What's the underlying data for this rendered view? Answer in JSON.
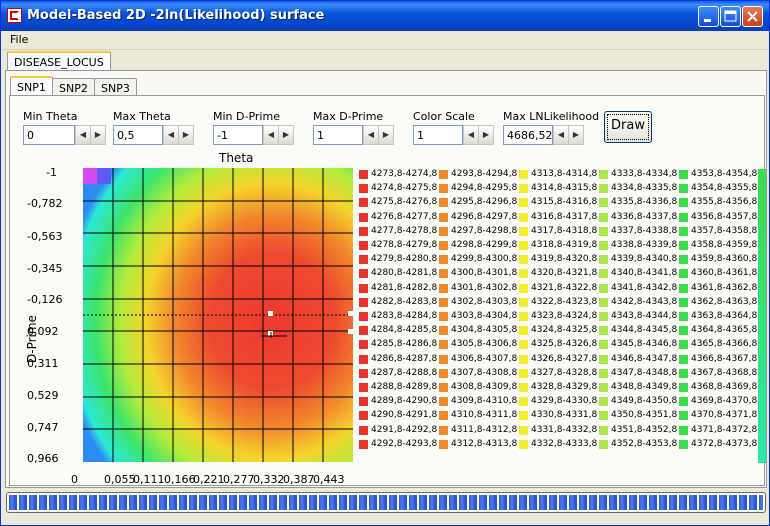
{
  "window": {
    "title": "Model-Based 2D -2ln(Likelihood) surface"
  },
  "menu": {
    "file": "File"
  },
  "tabs_outer": [
    "DISEASE_LOCUS"
  ],
  "tabs_inner": [
    "SNP1",
    "SNP2",
    "SNP3"
  ],
  "controls": {
    "min_theta": {
      "label": "Min Theta",
      "value": "0"
    },
    "max_theta": {
      "label": "Max Theta",
      "value": "0,5"
    },
    "min_dprime": {
      "label": "Min D-Prime",
      "value": "-1"
    },
    "max_dprime": {
      "label": "Max D-Prime",
      "value": "1"
    },
    "color_scale": {
      "label": "Color Scale",
      "value": "1"
    },
    "max_lnl": {
      "label": "Max LNLikelihood",
      "value": "4686,52"
    },
    "draw": "Draw"
  },
  "plot": {
    "x_title": "Theta",
    "y_title": "D-Prime",
    "y_ticks": [
      "-1",
      "-0,782",
      "-0,563",
      "-0,345",
      "-0,126",
      "0,092",
      "0,311",
      "0,529",
      "0,747",
      "0,966"
    ],
    "x_ticks": [
      "0",
      "0,055",
      "0,111",
      "0,166",
      "0,221",
      "0,277",
      "0,332",
      "0,387",
      "0,443"
    ]
  },
  "legend": {
    "columns": [
      [
        "4273,8-4274,8",
        "4274,8-4275,8",
        "4275,8-4276,8",
        "4276,8-4277,8",
        "4277,8-4278,8",
        "4278,8-4279,8",
        "4279,8-4280,8",
        "4280,8-4281,8",
        "4281,8-4282,8",
        "4282,8-4283,8",
        "4283,8-4284,8",
        "4284,8-4285,8",
        "4285,8-4286,8",
        "4286,8-4287,8",
        "4287,8-4288,8",
        "4288,8-4289,8",
        "4289,8-4290,8",
        "4290,8-4291,8",
        "4291,8-4292,8",
        "4292,8-4293,8"
      ],
      [
        "4293,8-4294,8",
        "4294,8-4295,8",
        "4295,8-4296,8",
        "4296,8-4297,8",
        "4297,8-4298,8",
        "4298,8-4299,8",
        "4299,8-4300,8",
        "4300,8-4301,8",
        "4301,8-4302,8",
        "4302,8-4303,8",
        "4303,8-4304,8",
        "4304,8-4305,8",
        "4305,8-4306,8",
        "4306,8-4307,8",
        "4307,8-4308,8",
        "4308,8-4309,8",
        "4309,8-4310,8",
        "4310,8-4311,8",
        "4311,8-4312,8",
        "4312,8-4313,8"
      ],
      [
        "4313,8-4314,8",
        "4314,8-4315,8",
        "4315,8-4316,8",
        "4316,8-4317,8",
        "4317,8-4318,8",
        "4318,8-4319,8",
        "4319,8-4320,8",
        "4320,8-4321,8",
        "4321,8-4322,8",
        "4322,8-4323,8",
        "4323,8-4324,8",
        "4324,8-4325,8",
        "4325,8-4326,8",
        "4326,8-4327,8",
        "4327,8-4328,8",
        "4328,8-4329,8",
        "4329,8-4330,8",
        "4330,8-4331,8",
        "4331,8-4332,8",
        "4332,8-4333,8"
      ],
      [
        "4333,8-4334,8",
        "4334,8-4335,8",
        "4335,8-4336,8",
        "4336,8-4337,8",
        "4337,8-4338,8",
        "4338,8-4339,8",
        "4339,8-4340,8",
        "4340,8-4341,8",
        "4341,8-4342,8",
        "4342,8-4343,8",
        "4343,8-4344,8",
        "4344,8-4345,8",
        "4345,8-4346,8",
        "4346,8-4347,8",
        "4347,8-4348,8",
        "4348,8-4349,8",
        "4349,8-4350,8",
        "4350,8-4351,8",
        "4351,8-4352,8",
        "4352,8-4353,8"
      ],
      [
        "4353,8-4354,8",
        "4354,8-4355,8",
        "4355,8-4356,8",
        "4356,8-4357,8",
        "4357,8-4358,8",
        "4358,8-4359,8",
        "4359,8-4360,8",
        "4360,8-4361,8",
        "4361,8-4362,8",
        "4362,8-4363,8",
        "4363,8-4364,8",
        "4364,8-4365,8",
        "4365,8-4366,8",
        "4366,8-4367,8",
        "4367,8-4368,8",
        "4368,8-4369,8",
        "4369,8-4370,8",
        "4370,8-4371,8",
        "4371,8-4372,8",
        "4372,8-4373,8"
      ]
    ],
    "column_colors": [
      "#e8342c",
      "#ee8a2c",
      "#f4ee2c",
      "#a8e84c",
      "#3cdc4c"
    ]
  },
  "colors": {
    "titlebar": "#0a5fef",
    "progress": "#2d55d1"
  },
  "progress_percent": 100
}
